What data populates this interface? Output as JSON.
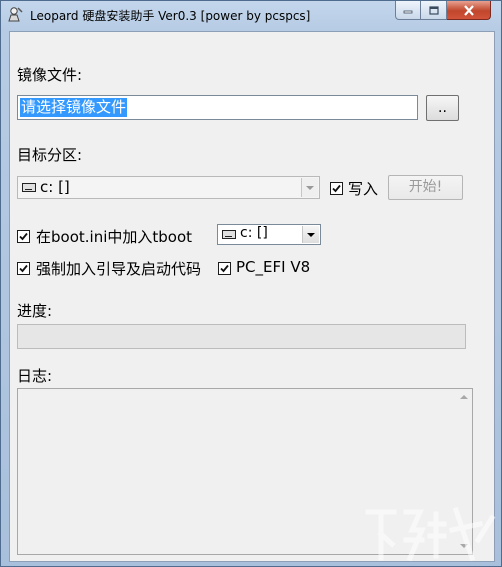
{
  "window": {
    "title": "Leopard 硬盘安装助手 Ver0.3 [power by pcspcs]"
  },
  "image_file": {
    "label": "镜像文件:",
    "value": "请选择镜像文件",
    "browse_label": ".."
  },
  "target_partition": {
    "label": "目标分区:",
    "selected": "c: []",
    "write_label": "写入",
    "write_checked": true,
    "start_label": "开始!"
  },
  "options": {
    "boot_ini_label": "在boot.ini中加入tboot",
    "boot_ini_checked": true,
    "boot_drive": "c: []",
    "force_boot_label": "强制加入引导及启动代码",
    "force_boot_checked": true,
    "pc_efi_label": "PC_EFI V8",
    "pc_efi_checked": true
  },
  "progress": {
    "label": "进度:",
    "value": 0
  },
  "log": {
    "label": "日志:"
  },
  "icons": {
    "app": "app-icon",
    "drive": "drive-icon",
    "minimize": "minimize-icon",
    "maximize": "maximize-icon",
    "close": "close-icon"
  },
  "colors": {
    "selection": "#3399ff",
    "close_button": "#c0462c",
    "progress_fill": "#3cb043"
  }
}
